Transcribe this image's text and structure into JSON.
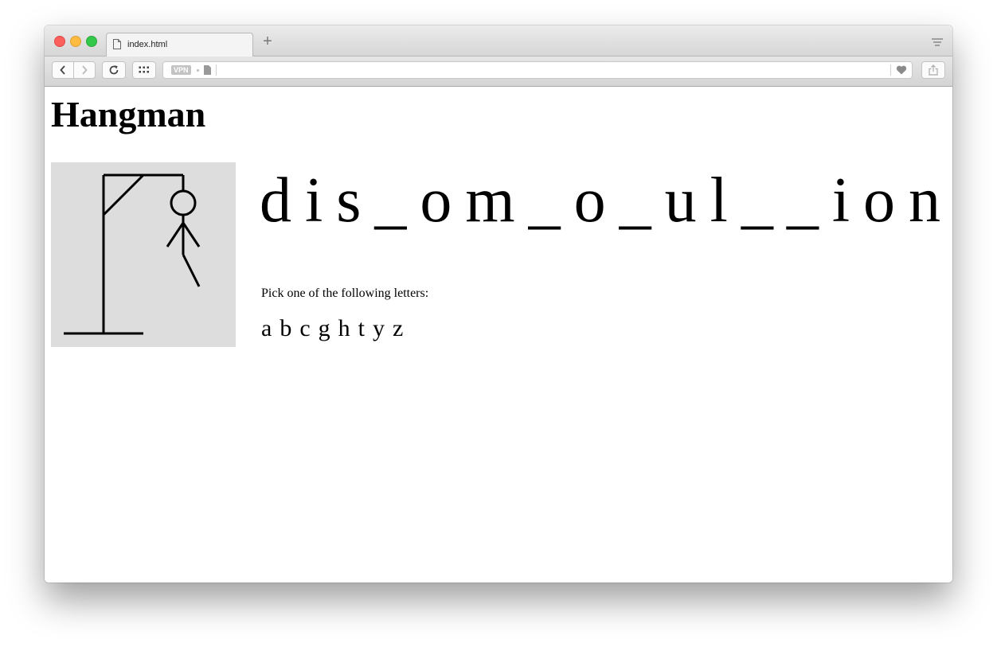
{
  "browser": {
    "tab_title": "index.html",
    "new_tab_symbol": "+",
    "vpn_label": "VPN"
  },
  "page": {
    "heading": "Hangman",
    "word_display": "dis_om_o_ul__ion",
    "prompt": "Pick one of the following letters:",
    "letters": [
      "a",
      "b",
      "c",
      "g",
      "h",
      "t",
      "y",
      "z"
    ]
  },
  "colors": {
    "gallows_background": "#dddddd",
    "text": "#000000"
  }
}
